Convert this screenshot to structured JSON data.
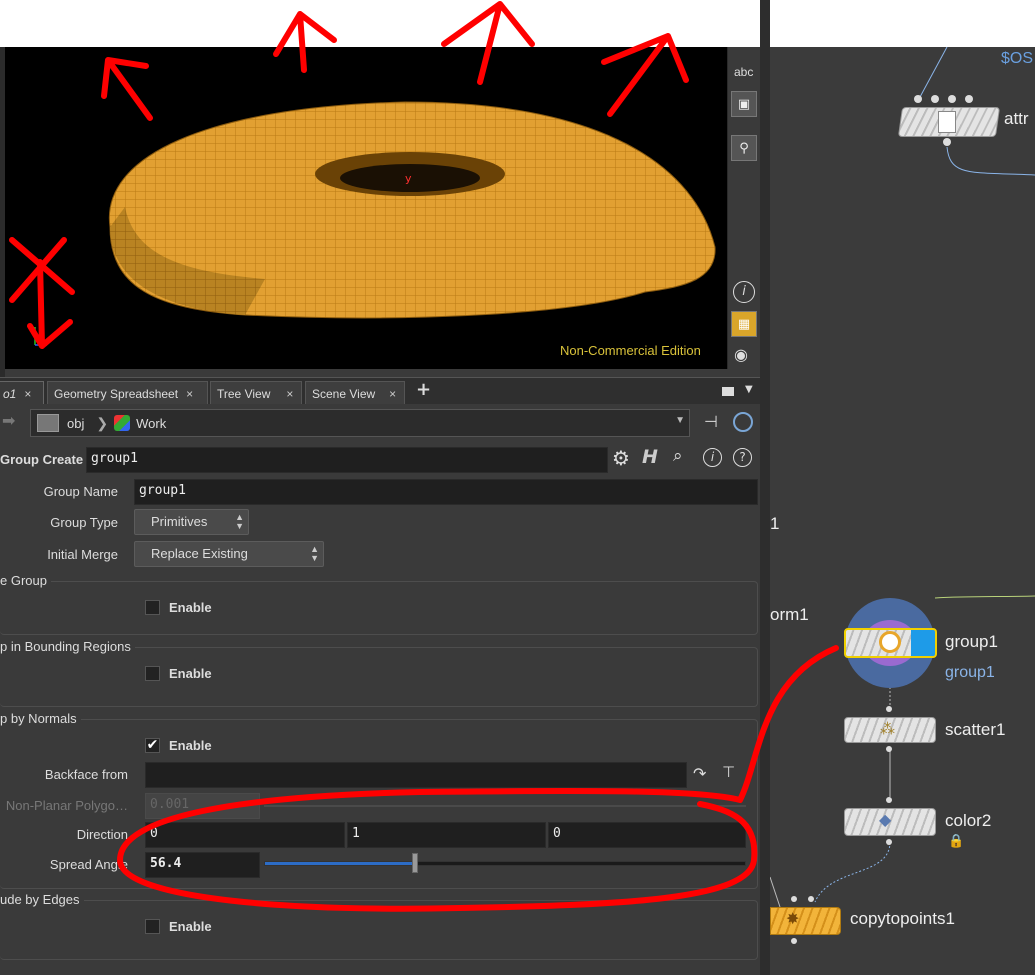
{
  "viewport": {
    "watermark": "Non-Commercial Edition",
    "axis_label": "y",
    "toolbar": {
      "abc_label": "abc",
      "info_glyph": "i"
    }
  },
  "tabs": [
    {
      "label": "o1"
    },
    {
      "label": "Geometry Spreadsheet"
    },
    {
      "label": "Tree View"
    },
    {
      "label": "Scene View"
    }
  ],
  "tab_close_glyph": "×",
  "tab_add_glyph": "+",
  "path": {
    "obj": "obj",
    "work": "Work"
  },
  "node_header": {
    "type_label": "Group Create",
    "name_value": "group1"
  },
  "params": {
    "group_name": {
      "label": "Group Name",
      "value": "group1"
    },
    "group_type": {
      "label": "Group Type",
      "value": "Primitives"
    },
    "initial_merge": {
      "label": "Initial Merge",
      "value": "Replace Existing"
    },
    "base_group": {
      "title": "e Group",
      "enable_label": "Enable"
    },
    "bounding": {
      "title": "p in Bounding Regions",
      "enable_label": "Enable"
    },
    "normals": {
      "title": "p by Normals",
      "enable_label": "Enable",
      "enabled": true,
      "backface_label": "Backface from",
      "backface_value": "",
      "nonplanar_label": "Non-Planar Polygo…",
      "nonplanar_value": "0.001",
      "direction_label": "Direction",
      "direction": [
        "0",
        "1",
        "0"
      ],
      "spread_label": "Spread Angle",
      "spread_value": "56.4",
      "spread_fraction": 0.313
    },
    "edges": {
      "title": "ude by Edges",
      "enable_label": "Enable"
    }
  },
  "network": {
    "os_label": "$OS",
    "attr_label": "attr",
    "partial_label_1": "1",
    "partial_label_2": "orm1",
    "nodes": [
      {
        "name": "group1",
        "sublabel": "group1"
      },
      {
        "name": "scatter1"
      },
      {
        "name": "color2"
      },
      {
        "name": "copytopoints1"
      }
    ]
  },
  "colors": {
    "accent_yellow": "#e8a62a",
    "annotation_red": "#ff0000",
    "node_blue": "#1e9be8",
    "link_blue": "#8ab4e8"
  }
}
